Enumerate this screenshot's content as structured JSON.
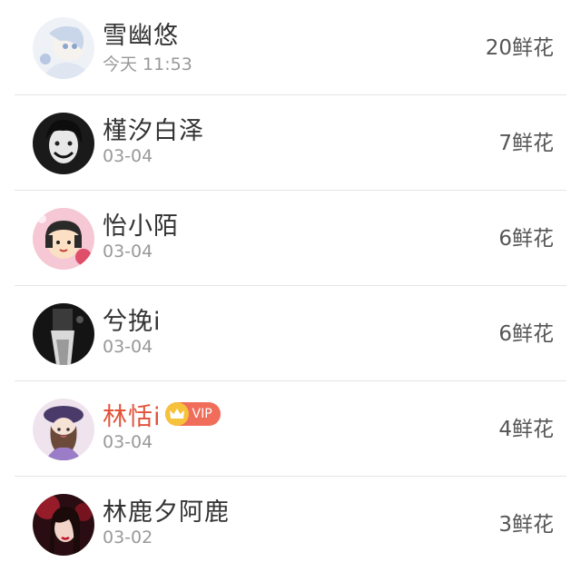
{
  "ranking_list": [
    {
      "name": "雪幽悠",
      "time": "今天 11:53",
      "flowers": "20鲜花",
      "avatar": "avatar-light-blue-girl-icon",
      "vip": false
    },
    {
      "name": "槿汐白泽",
      "time": "03-04",
      "flowers": "7鲜花",
      "avatar": "avatar-dark-smiling-face-icon",
      "vip": false
    },
    {
      "name": "怡小陌",
      "time": "03-04",
      "flowers": "6鲜花",
      "avatar": "avatar-cartoon-girl-icon",
      "vip": false
    },
    {
      "name": "兮挽i",
      "time": "03-04",
      "flowers": "6鲜花",
      "avatar": "avatar-dark-photo-icon",
      "vip": false
    },
    {
      "name": "林恬i",
      "time": "03-04",
      "flowers": "4鲜花",
      "avatar": "avatar-girl-purple-hat-icon",
      "vip": true,
      "vip_label": "VIP"
    },
    {
      "name": "林鹿夕阿鹿",
      "time": "03-02",
      "flowers": "3鲜花",
      "avatar": "avatar-red-dark-girl-icon",
      "vip": false
    }
  ],
  "colors": {
    "vip_name": "#e2533a",
    "vip_badge": "#ef6d5a",
    "vip_crown": "#f7c23b",
    "name_text": "#333333",
    "meta_text": "#999999",
    "divider": "#e5e5e5"
  }
}
